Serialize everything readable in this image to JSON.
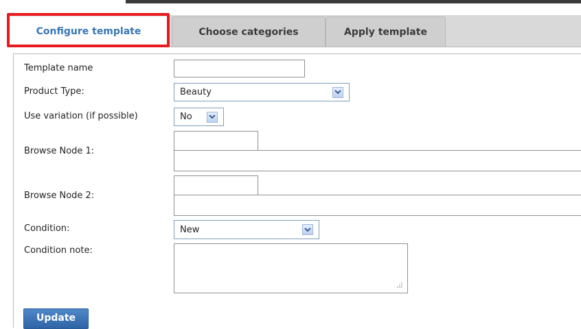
{
  "tabs": [
    {
      "label": "Configure template",
      "active": true
    },
    {
      "label": "Choose categories",
      "active": false
    },
    {
      "label": "Apply template",
      "active": false
    }
  ],
  "form": {
    "template_name": {
      "label": "Template name",
      "value": ""
    },
    "product_type": {
      "label": "Product Type:",
      "value": "Beauty"
    },
    "use_variation": {
      "label": "Use variation (if possible)",
      "value": "No"
    },
    "browse_node_1": {
      "label": "Browse Node 1:",
      "value": "",
      "path": ""
    },
    "browse_node_2": {
      "label": "Browse Node 2:",
      "value": "",
      "path": ""
    },
    "condition": {
      "label": "Condition:",
      "value": "New"
    },
    "condition_note": {
      "label": "Condition note:",
      "value": ""
    }
  },
  "update_label": "Update",
  "colors": {
    "active_tab_text": "#3a76b5",
    "highlight": "#e8191e",
    "update_button": "#3a72b8"
  }
}
